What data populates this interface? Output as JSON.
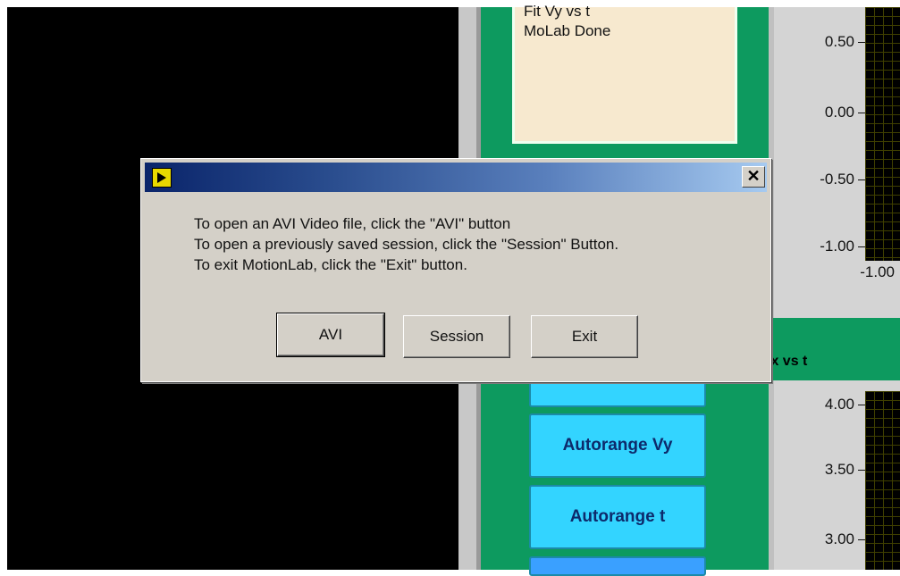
{
  "log": {
    "lines": [
      "Fit Vy vs t",
      "MoLab Done"
    ]
  },
  "graph_top": {
    "ticks": [
      "0.50",
      "0.00",
      "-0.50",
      "-1.00"
    ],
    "x_tick": "-1.00"
  },
  "graph_bottom": {
    "title": "/x vs t",
    "ticks": [
      "4.00",
      "3.50",
      "3.00"
    ]
  },
  "side_buttons": {
    "autorange_vy": "Autorange Vy",
    "autorange_t": "Autorange t"
  },
  "dialog": {
    "close_glyph": "✕",
    "messages": [
      "To open an AVI Video file, click the  \"AVI\" button",
      "To open a previously saved session, click the \"Session\" Button.",
      "To exit MotionLab, click the \"Exit\" button."
    ],
    "buttons": {
      "avi": "AVI",
      "session": "Session",
      "exit": "Exit"
    },
    "icon": "labview-run-icon"
  },
  "colors": {
    "panel_green": "#0d9a5f",
    "button_cyan": "#33d4ff",
    "log_bg": "#f7e9cf",
    "dialog_gray": "#d4d0c8"
  }
}
